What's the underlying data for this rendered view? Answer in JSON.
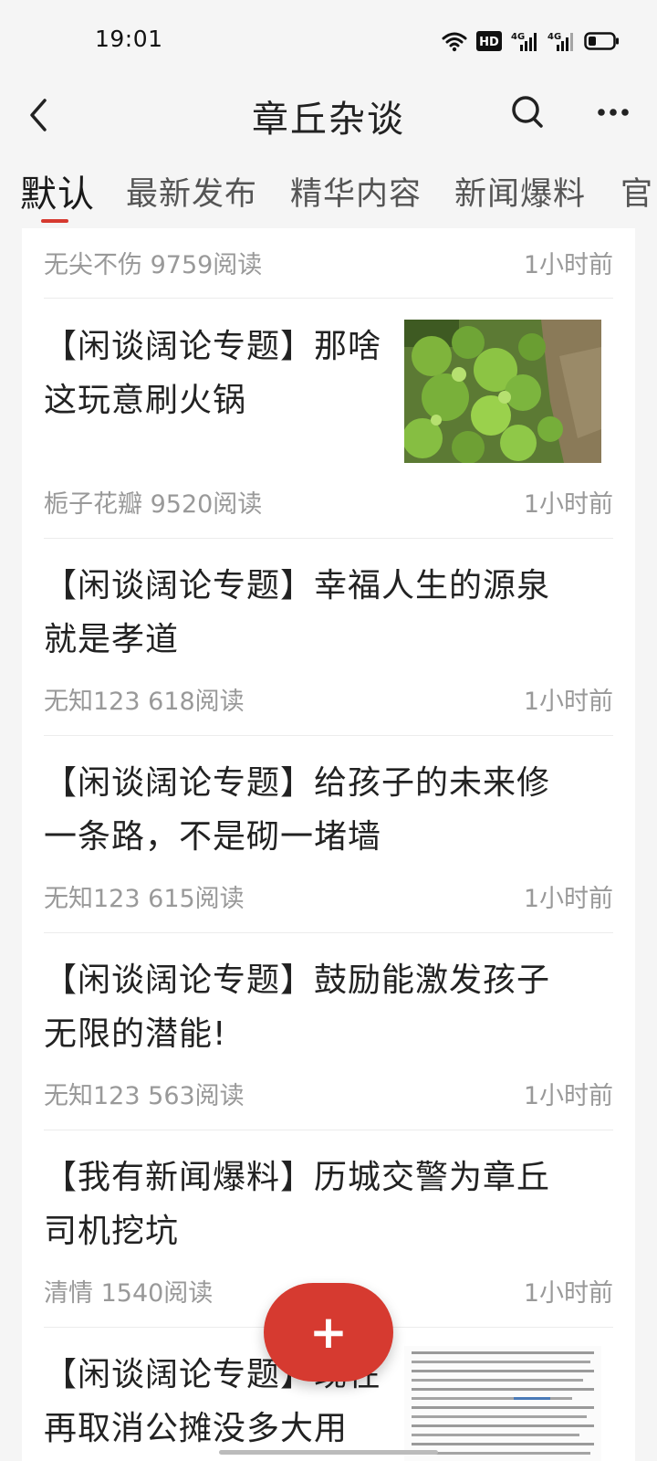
{
  "status_bar": {
    "time": "19:01",
    "hd_badge": "HD",
    "signal1": "4G",
    "signal2": "4G",
    "battery_level": 0.3
  },
  "nav": {
    "title": "章丘杂谈"
  },
  "tabs": [
    {
      "label": "默认",
      "active": true
    },
    {
      "label": "最新发布",
      "active": false
    },
    {
      "label": "精华内容",
      "active": false
    },
    {
      "label": "新闻爆料",
      "active": false
    },
    {
      "label": "官",
      "active": false
    }
  ],
  "posts": [
    {
      "title_line1": "",
      "title_line2": "",
      "author": "无尖不伤",
      "reads": "9759阅读",
      "time": "1小时前"
    },
    {
      "title_line1": "【闲谈阔论专题】那啥",
      "title_line2": "这玩意刷火锅",
      "author": "栀子花瓣",
      "reads": "9520阅读",
      "time": "1小时前",
      "thumb": "green-leaves-photo"
    },
    {
      "title_line1": "【闲谈阔论专题】幸福人生的源泉",
      "title_line2": "就是孝道",
      "author": "无知123",
      "reads": "618阅读",
      "time": "1小时前"
    },
    {
      "title_line1": "【闲谈阔论专题】给孩子的未来修",
      "title_line2": "一条路，不是砌一堵墙",
      "author": "无知123",
      "reads": "615阅读",
      "time": "1小时前"
    },
    {
      "title_line1": "【闲谈阔论专题】鼓励能激发孩子",
      "title_line2": "无限的潜能!",
      "author": "无知123",
      "reads": "563阅读",
      "time": "1小时前"
    },
    {
      "title_line1": "【我有新闻爆料】历城交警为章丘",
      "title_line2": "司机挖坑",
      "author": "清情",
      "reads": "1540阅读",
      "time": "1小时前"
    },
    {
      "title_line1": "【闲谈阔论专题】现在",
      "title_line2": "再取消公摊没多大用",
      "thumb": "news-text-screenshot"
    }
  ],
  "fab": {
    "label": "+"
  }
}
